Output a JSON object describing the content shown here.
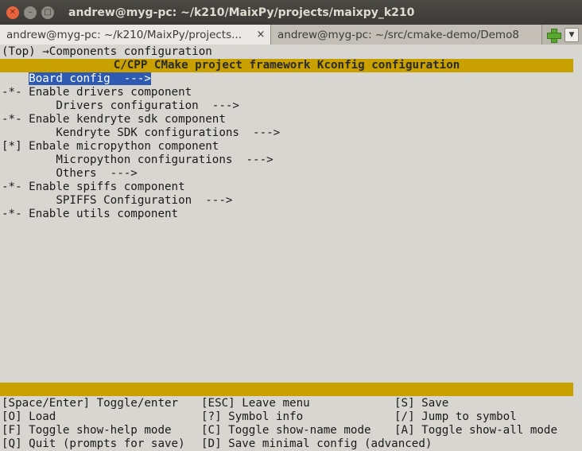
{
  "window": {
    "title": "andrew@myg-pc: ~/k210/MaixPy/projects/maixpy_k210"
  },
  "tabs": [
    {
      "label": "andrew@myg-pc: ~/k210/MaixPy/projects...",
      "active": true
    },
    {
      "label": "andrew@myg-pc: ~/src/cmake-demo/Demo8",
      "active": false
    }
  ],
  "tab_close_glyph": "×",
  "terminal": {
    "breadcrumb": "(Top) →Components configuration",
    "banner": "C/CPP CMake project framework Kconfig configuration",
    "menu": [
      {
        "text": "    Board config  --->",
        "selected": true
      },
      {
        "text": "-*- Enable drivers component",
        "selected": false
      },
      {
        "text": "        Drivers configuration  --->",
        "selected": false
      },
      {
        "text": "-*- Enable kendryte sdk component",
        "selected": false
      },
      {
        "text": "        Kendryte SDK configurations  --->",
        "selected": false
      },
      {
        "text": "[*] Enbale micropython component",
        "selected": false
      },
      {
        "text": "        Micropython configurations  --->",
        "selected": false
      },
      {
        "text": "        Others  --->",
        "selected": false
      },
      {
        "text": "-*- Enable spiffs component",
        "selected": false
      },
      {
        "text": "        SPIFFS Configuration  --->",
        "selected": false
      },
      {
        "text": "-*- Enable utils component",
        "selected": false
      }
    ],
    "help": [
      [
        "[Space/Enter] Toggle/enter",
        "[ESC] Leave menu",
        "[S] Save"
      ],
      [
        "[O] Load",
        "[?] Symbol info",
        "[/] Jump to symbol"
      ],
      [
        "[F] Toggle show-help mode",
        "[C] Toggle show-name mode",
        "[A] Toggle show-all mode"
      ],
      [
        "[Q] Quit (prompts for save)",
        "[D] Save minimal config (advanced)",
        ""
      ]
    ]
  },
  "colors": {
    "banner": "#c8a000",
    "selection": "#2e5ab2",
    "terminal_bg": "#d8d6d1"
  }
}
